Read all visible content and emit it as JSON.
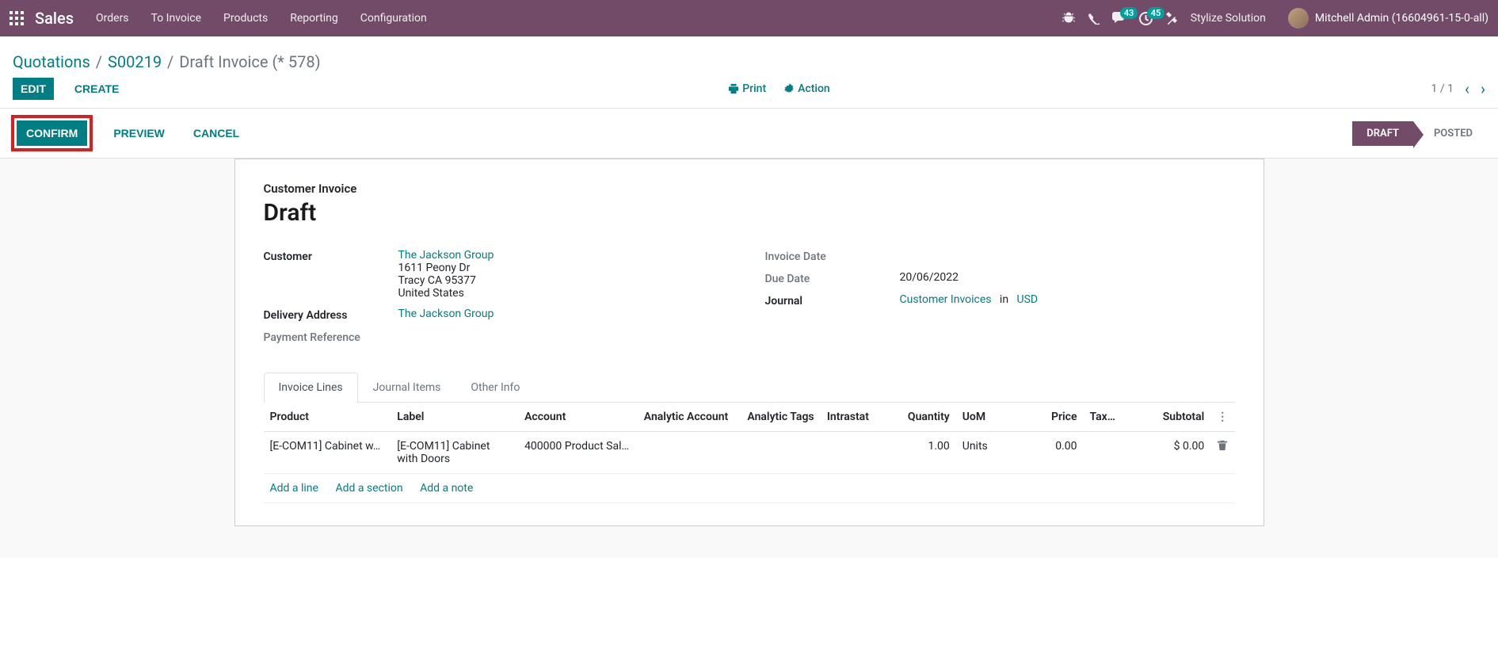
{
  "navbar": {
    "brand": "Sales",
    "links": [
      "Orders",
      "To Invoice",
      "Products",
      "Reporting",
      "Configuration"
    ],
    "messages_count": "43",
    "activities_count": "45",
    "company": "Stylize Solution",
    "user": "Mitchell Admin (16604961-15-0-all)"
  },
  "breadcrumb": {
    "root": "Quotations",
    "parent": "S00219",
    "current": "Draft Invoice (* 578)"
  },
  "cp": {
    "edit": "EDIT",
    "create": "CREATE",
    "print": "Print",
    "action": "Action",
    "pager": "1 / 1"
  },
  "statusbar": {
    "confirm": "CONFIRM",
    "preview": "PREVIEW",
    "cancel": "CANCEL",
    "draft": "DRAFT",
    "posted": "POSTED"
  },
  "form": {
    "subtitle": "Customer Invoice",
    "title": "Draft",
    "labels": {
      "customer": "Customer",
      "delivery": "Delivery Address",
      "payment_ref": "Payment Reference",
      "invoice_date": "Invoice Date",
      "due_date": "Due Date",
      "journal": "Journal",
      "in": "in"
    },
    "customer": {
      "name": "The Jackson Group",
      "addr1": "1611 Peony Dr",
      "addr2": "Tracy CA 95377",
      "addr3": "United States"
    },
    "delivery": "The Jackson Group",
    "due_date": "20/06/2022",
    "journal": "Customer Invoices",
    "currency": "USD"
  },
  "tabs": [
    "Invoice Lines",
    "Journal Items",
    "Other Info"
  ],
  "table": {
    "headers": {
      "product": "Product",
      "label": "Label",
      "account": "Account",
      "analytic_account": "Analytic Account",
      "analytic_tags": "Analytic Tags",
      "intrastat": "Intrastat",
      "quantity": "Quantity",
      "uom": "UoM",
      "price": "Price",
      "taxes": "Tax…",
      "subtotal": "Subtotal"
    },
    "rows": [
      {
        "product": "[E-COM11] Cabinet w…",
        "label": "[E-COM11] Cabinet with Doors",
        "account": "400000 Product Sal…",
        "quantity": "1.00",
        "uom": "Units",
        "price": "0.00",
        "subtotal": "$ 0.00"
      }
    ],
    "actions": {
      "add_line": "Add a line",
      "add_section": "Add a section",
      "add_note": "Add a note"
    }
  }
}
